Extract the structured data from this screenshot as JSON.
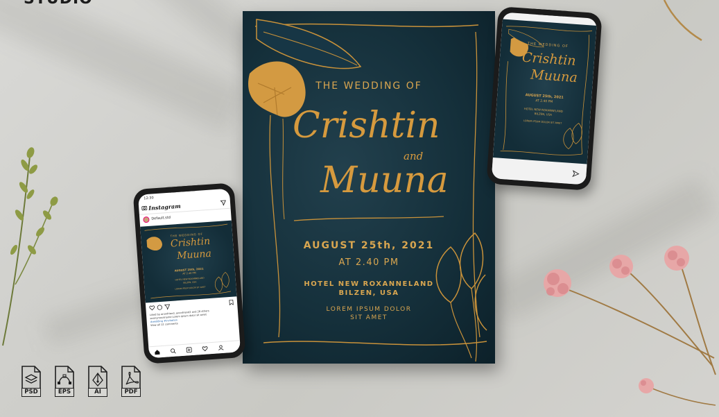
{
  "brand": {
    "partial_text": "STUDIO"
  },
  "poster": {
    "subtitle": "THE WEDDING OF",
    "name_first": "Crishtin",
    "conjunction": "and",
    "name_second": "Muuna",
    "date": "AUGUST 25th, 2021",
    "time": "AT 2.40 PM",
    "venue": "HOTEL NEW ROXANNELAND",
    "city": "BILZEN, USA",
    "lorem_line1": "LOREM IPSUM DOLOR",
    "lorem_line2": "SIT AMET",
    "accent_color": "#d69a3e",
    "background_color": "#15303b"
  },
  "story_phone": {
    "subtitle": "THE WEDDING OF",
    "name_first": "Crishtin",
    "conjunction": "and",
    "name_second": "Muuna",
    "date": "AUGUST 25th, 2021",
    "time": "AT 2.40 PM",
    "venue": "HOTEL NEW ROXANNELAND",
    "city": "BILZEN, USA",
    "lorem": "LOREM IPSUM DOLOR SIT AMET",
    "icons": [
      "send-icon"
    ]
  },
  "instagram_phone": {
    "status_time": "12:30",
    "app_name": "Instagram",
    "username": "Default.std",
    "post": {
      "subtitle": "THE WEDDING OF",
      "name_first": "Crishtin",
      "name_second": "Muuna",
      "date": "AUGUST 25th, 2021",
      "time": "AT 2.40 PM",
      "venue": "HOTEL NEW ROXANNELAND",
      "city": "BILZEN, USA",
      "lorem": "LOREM IPSUM DOLOR SIT AMET"
    },
    "caption_line1": "Liked by anonfriend, anonfriend2 and 28 others",
    "caption_line2": "anonymousname Lorem ipsum dolor sit amet",
    "caption_tags": "#wedding #invitation",
    "caption_line3": "View all 12 comments",
    "icons": [
      "camera-icon",
      "send-icon",
      "heart-icon",
      "comment-icon",
      "share-icon",
      "bookmark-icon",
      "home-icon",
      "search-icon",
      "add-icon",
      "activity-icon",
      "profile-icon"
    ]
  },
  "file_badges": [
    {
      "label": "PSD",
      "icon": "layers-icon"
    },
    {
      "label": "EPS",
      "icon": "vector-curve-icon"
    },
    {
      "label": "AI",
      "icon": "pen-nib-icon"
    },
    {
      "label": "PDF",
      "icon": "pdf-acrobat-icon"
    }
  ]
}
